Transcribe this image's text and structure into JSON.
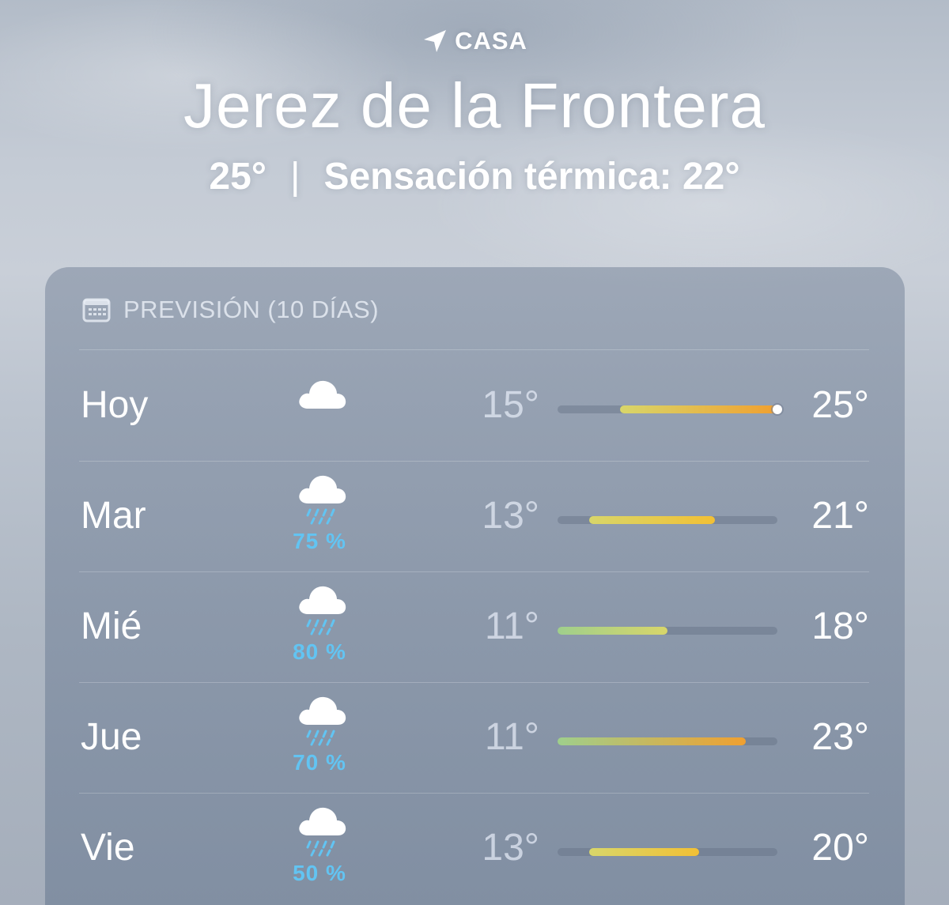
{
  "location": {
    "label": "CASA",
    "icon": "location-arrow-icon"
  },
  "city": "Jerez de la Frontera",
  "current": {
    "temp": "25°",
    "separator": "|",
    "feels_like": "Sensación térmica: 22°"
  },
  "forecast": {
    "title": "PREVISIÓN (10 DÍAS)",
    "icon": "calendar-icon",
    "colors": {
      "precip": "#62c4f2",
      "cool": "#9fcf8c",
      "mild": "#d8d66a",
      "warm": "#f2c035",
      "hot": "#f0a030"
    },
    "range_min": 11,
    "range_max": 25,
    "days": [
      {
        "day": "Hoy",
        "icon": "cloud-icon",
        "precip": "",
        "low": "15°",
        "high": "25°",
        "low_value": 15,
        "high_value": 25,
        "current_value": 25
      },
      {
        "day": "Mar",
        "icon": "cloud-rain-icon",
        "precip": "75 %",
        "low": "13°",
        "high": "21°",
        "low_value": 13,
        "high_value": 21
      },
      {
        "day": "Mié",
        "icon": "cloud-rain-icon",
        "precip": "80 %",
        "low": "11°",
        "high": "18°",
        "low_value": 11,
        "high_value": 18
      },
      {
        "day": "Jue",
        "icon": "cloud-rain-icon",
        "precip": "70 %",
        "low": "11°",
        "high": "23°",
        "low_value": 11,
        "high_value": 23
      },
      {
        "day": "Vie",
        "icon": "cloud-rain-icon",
        "precip": "50 %",
        "low": "13°",
        "high": "20°",
        "low_value": 13,
        "high_value": 20
      }
    ]
  }
}
